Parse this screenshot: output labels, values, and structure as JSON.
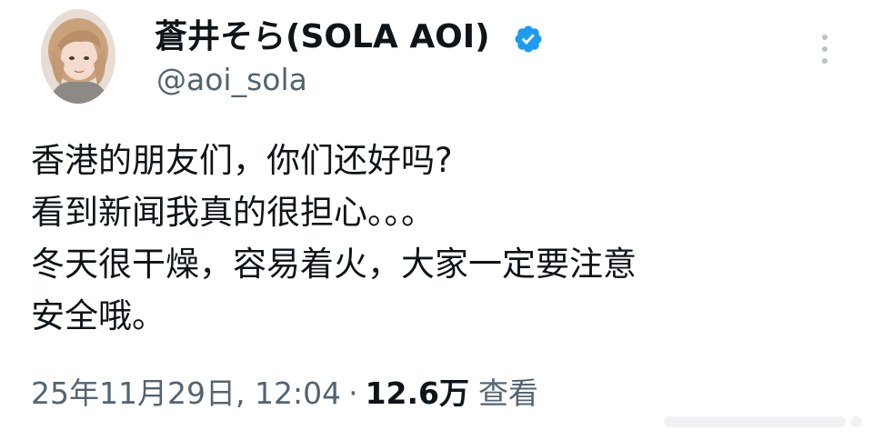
{
  "author": {
    "display_name": "蒼井そら(SOLA AOI)",
    "handle": "@aoi_sola",
    "verified": true
  },
  "tweet": {
    "lines": [
      "香港的朋友们，你们还好吗?",
      "看到新闻我真的很担心。。。",
      "冬天很干燥，容易着火，大家一定要注意",
      "安全哦。"
    ]
  },
  "meta": {
    "timestamp": "25年11月29日, 12:04",
    "separator": "·",
    "views_count": "12.6万",
    "views_label": "查看"
  },
  "colors": {
    "text": "#0f1419",
    "secondary": "#536471",
    "verified": "#1d9bf0"
  }
}
